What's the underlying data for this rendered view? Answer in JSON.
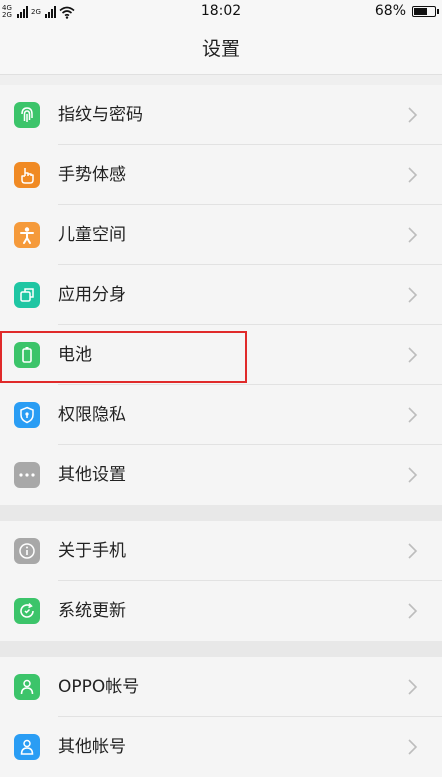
{
  "status_bar": {
    "network_labels": [
      "4G",
      "2G"
    ],
    "network_label_2": "2G",
    "time": "18:02",
    "battery_percent": "68%",
    "battery_level": 0.68
  },
  "header": {
    "title": "设置"
  },
  "groups": [
    {
      "items": [
        {
          "label": "指纹与密码",
          "icon": "fingerprint-icon",
          "color": "#3cc46a"
        },
        {
          "label": "手势体感",
          "icon": "hand-gesture-icon",
          "color": "#f08a24"
        },
        {
          "label": "儿童空间",
          "icon": "child-icon",
          "color": "#f59a3b"
        },
        {
          "label": "应用分身",
          "icon": "app-clone-icon",
          "color": "#1fc6a3"
        },
        {
          "label": "电池",
          "icon": "battery-icon",
          "color": "#3cc46a",
          "highlighted": true
        },
        {
          "label": "权限隐私",
          "icon": "shield-icon",
          "color": "#2a9df4"
        },
        {
          "label": "其他设置",
          "icon": "more-dots-icon",
          "color": "#a8a8a8"
        }
      ]
    },
    {
      "items": [
        {
          "label": "关于手机",
          "icon": "info-icon",
          "color": "#a8a8a8"
        },
        {
          "label": "系统更新",
          "icon": "system-update-icon",
          "color": "#3cc46a"
        }
      ]
    },
    {
      "items": [
        {
          "label": "OPPO帐号",
          "icon": "account-icon",
          "color": "#3cc46a"
        },
        {
          "label": "其他帐号",
          "icon": "user-icon",
          "color": "#2a9df4"
        }
      ]
    }
  ]
}
